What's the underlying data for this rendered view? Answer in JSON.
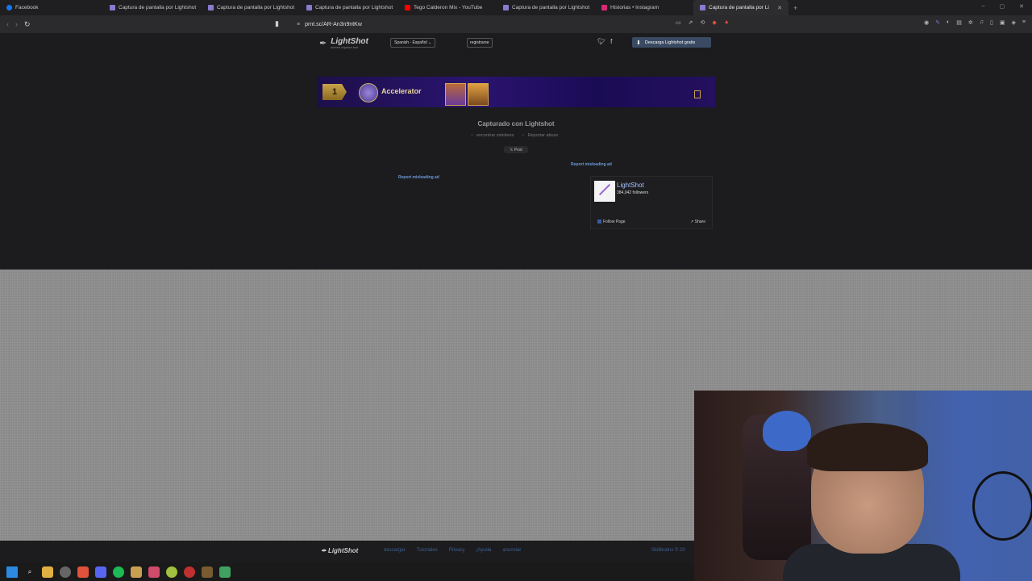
{
  "browser": {
    "tabs": [
      {
        "label": "Facebook",
        "color": "#1877f2",
        "active": false
      },
      {
        "label": "Captura de pantalla por Lightshot",
        "color": "#8a7ad0",
        "active": false
      },
      {
        "label": "Captura de pantalla por Lightshot",
        "color": "#8a7ad0",
        "active": false
      },
      {
        "label": "Captura de pantalla por Lightshot",
        "color": "#8a7ad0",
        "active": false
      },
      {
        "label": "Tego Calderon Mix - YouTube",
        "color": "#ff0000",
        "active": false
      },
      {
        "label": "Captura de pantalla por Lightshot",
        "color": "#8a7ad0",
        "active": false
      },
      {
        "label": "Historias • Instagram",
        "color": "#d62976",
        "active": false
      },
      {
        "label": "Captura de pantalla por Lightshot",
        "color": "#8a7ad0",
        "active": true
      }
    ],
    "new_tab": "+",
    "url": "prnt.sc/AR-An3n9ntKw"
  },
  "site": {
    "logo_text": "LightShot",
    "logo_tagline": "screen capture tool",
    "language": "Spanish - Español ⌄",
    "register": "registrarse",
    "download_button": "Descarga Lightshot gratis"
  },
  "banner": {
    "rank": "1",
    "name": "Accelerator"
  },
  "content": {
    "caption": "Capturado con Lightshot",
    "find_similar": "encontrar similares",
    "report_abuse": "Reportar abuso",
    "post_button": "𝕏 Post",
    "report_ad_left": "Report misleading ad",
    "report_ad_right": "Report misleading ad"
  },
  "facebook_widget": {
    "page_name": "LightShot",
    "followers": "384,042 followers",
    "follow": "Follow Page",
    "share": "Share"
  },
  "footer": {
    "logo": "LightShot",
    "links": [
      "descargar",
      "Tutoriales",
      "Privacy",
      "¡Ayuda",
      "anunciar"
    ],
    "copyright": "Skillbrains © 20"
  }
}
